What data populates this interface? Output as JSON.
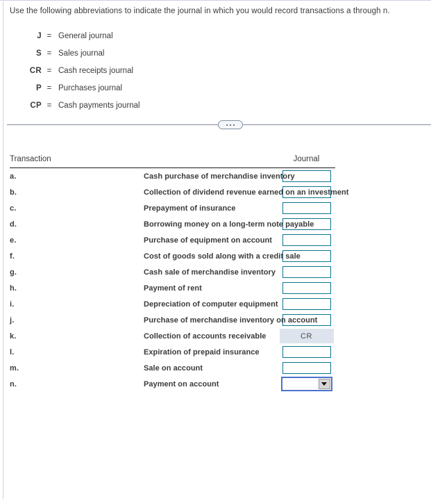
{
  "instructions": "Use the following abbreviations to indicate the journal in which you would record transactions a through n.",
  "legend": {
    "equals_symbol": "=",
    "items": [
      {
        "abbr": "J",
        "meaning": "General journal"
      },
      {
        "abbr": "S",
        "meaning": "Sales journal"
      },
      {
        "abbr": "CR",
        "meaning": "Cash receipts journal"
      },
      {
        "abbr": "P",
        "meaning": "Purchases journal"
      },
      {
        "abbr": "CP",
        "meaning": "Cash payments journal"
      }
    ]
  },
  "divider": {
    "dots_label": "..."
  },
  "table": {
    "headers": {
      "transaction": "Transaction",
      "journal": "Journal"
    },
    "rows": [
      {
        "letter": "a.",
        "description": "Cash purchase of merchandise inventory",
        "answer": "",
        "control": "input"
      },
      {
        "letter": "b.",
        "description": "Collection of dividend revenue earned on an investment",
        "answer": "",
        "control": "input"
      },
      {
        "letter": "c.",
        "description": "Prepayment of insurance",
        "answer": "",
        "control": "input"
      },
      {
        "letter": "d.",
        "description": "Borrowing money on a long-term note payable",
        "answer": "",
        "control": "input"
      },
      {
        "letter": "e.",
        "description": "Purchase of equipment on account",
        "answer": "",
        "control": "input"
      },
      {
        "letter": "f.",
        "description": "Cost of goods sold along with a credit sale",
        "answer": "",
        "control": "input"
      },
      {
        "letter": "g.",
        "description": "Cash sale of merchandise inventory",
        "answer": "",
        "control": "input"
      },
      {
        "letter": "h.",
        "description": "Payment of rent",
        "answer": "",
        "control": "input"
      },
      {
        "letter": "i.",
        "description": "Depreciation of computer equipment",
        "answer": "",
        "control": "input"
      },
      {
        "letter": "j.",
        "description": "Purchase of merchandise inventory on account",
        "answer": "",
        "control": "input"
      },
      {
        "letter": "k.",
        "description": "Collection of accounts receivable",
        "answer": "CR",
        "control": "filled"
      },
      {
        "letter": "l.",
        "description": "Expiration of prepaid insurance",
        "answer": "",
        "control": "input"
      },
      {
        "letter": "m.",
        "description": "Sale on account",
        "answer": "",
        "control": "input"
      },
      {
        "letter": "n.",
        "description": "Payment on account",
        "answer": "",
        "control": "select"
      }
    ]
  },
  "colors": {
    "input_border": "#0c7490",
    "filled_background": "#dde4ee",
    "focus_border": "#4a72d0",
    "header_rule": "#1a1a1a",
    "divider_rule": "#7f8a9e",
    "text": "#3b3b3b"
  }
}
